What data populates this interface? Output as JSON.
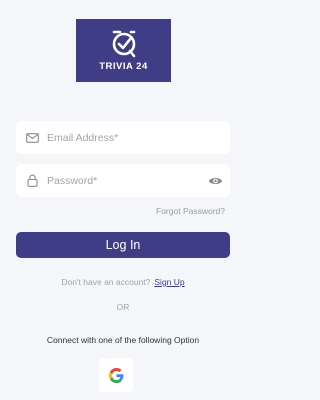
{
  "logo": {
    "text": "TRIVIA 24",
    "bg_color": "#3f3d86"
  },
  "email": {
    "placeholder": "Email Address*",
    "icon": "mail-icon"
  },
  "password": {
    "placeholder": "Password*",
    "icon": "lock-icon",
    "toggle_icon": "eye-icon"
  },
  "forgot_password": "Forgot Password?",
  "login_button": "Log In",
  "signup": {
    "prompt": "Don't have an account?",
    "link": "Sign Up"
  },
  "divider": "OR",
  "connect_text": "Connect with one of the following Option",
  "social": {
    "icon": "google-icon"
  },
  "colors": {
    "primary": "#3f3d86",
    "background": "#f4f6fa"
  }
}
